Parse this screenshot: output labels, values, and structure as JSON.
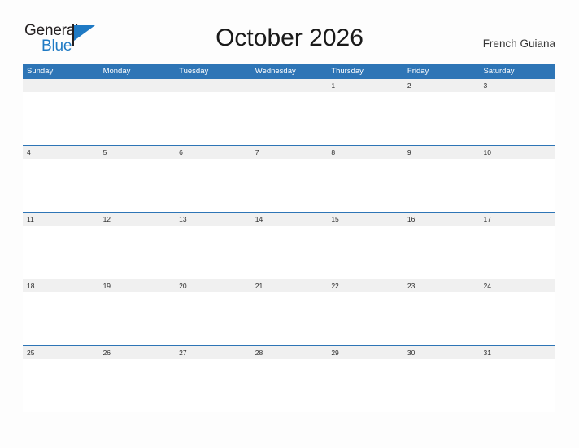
{
  "brand": {
    "name_part1": "General",
    "name_part2": "Blue",
    "flag_icon": "blue-flag-icon",
    "accent_color": "#1f7ac4"
  },
  "header": {
    "title": "October 2026",
    "month": "October",
    "year": "2026",
    "locale": "French Guiana"
  },
  "theme": {
    "header_band": "#2e75b6",
    "date_band": "#f0f0f0",
    "row_rule": "#2e75b6",
    "page_background": "#fdfdfd",
    "text": "#2b2b2b"
  },
  "calendar": {
    "weekday_headers": [
      "Sunday",
      "Monday",
      "Tuesday",
      "Wednesday",
      "Thursday",
      "Friday",
      "Saturday"
    ],
    "weeks": [
      {
        "days": [
          "",
          "",
          "",
          "",
          "1",
          "2",
          "3"
        ]
      },
      {
        "days": [
          "4",
          "5",
          "6",
          "7",
          "8",
          "9",
          "10"
        ]
      },
      {
        "days": [
          "11",
          "12",
          "13",
          "14",
          "15",
          "16",
          "17"
        ]
      },
      {
        "days": [
          "18",
          "19",
          "20",
          "21",
          "22",
          "23",
          "24"
        ]
      },
      {
        "days": [
          "25",
          "26",
          "27",
          "28",
          "29",
          "30",
          "31"
        ]
      }
    ]
  }
}
